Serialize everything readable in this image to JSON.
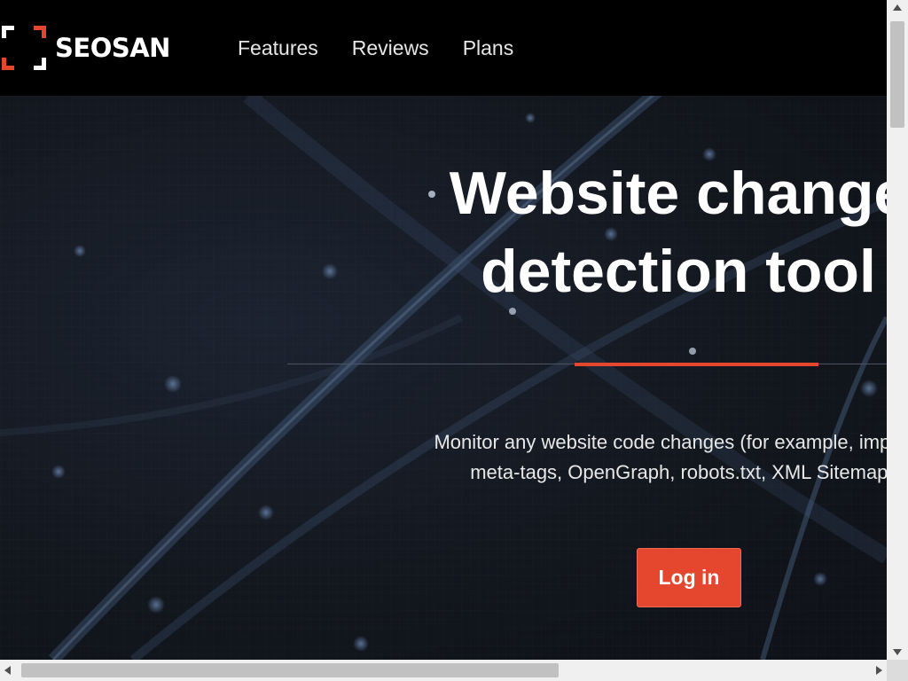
{
  "brand": {
    "name": "SEOSAN",
    "accent": "#e5462e"
  },
  "nav": {
    "items": [
      {
        "label": "Features"
      },
      {
        "label": "Reviews"
      },
      {
        "label": "Plans"
      }
    ]
  },
  "hero": {
    "headline_line1": "Website change",
    "headline_line2": "detection tool",
    "subtext_line1": "Monitor any website code changes (for example, important",
    "subtext_line2": "meta-tags, OpenGraph, robots.txt, XML Sitemap a",
    "login_label": "Log in"
  },
  "colors": {
    "header_bg": "#000000",
    "hero_bg": "#12161d",
    "button_bg": "#e5462e"
  }
}
